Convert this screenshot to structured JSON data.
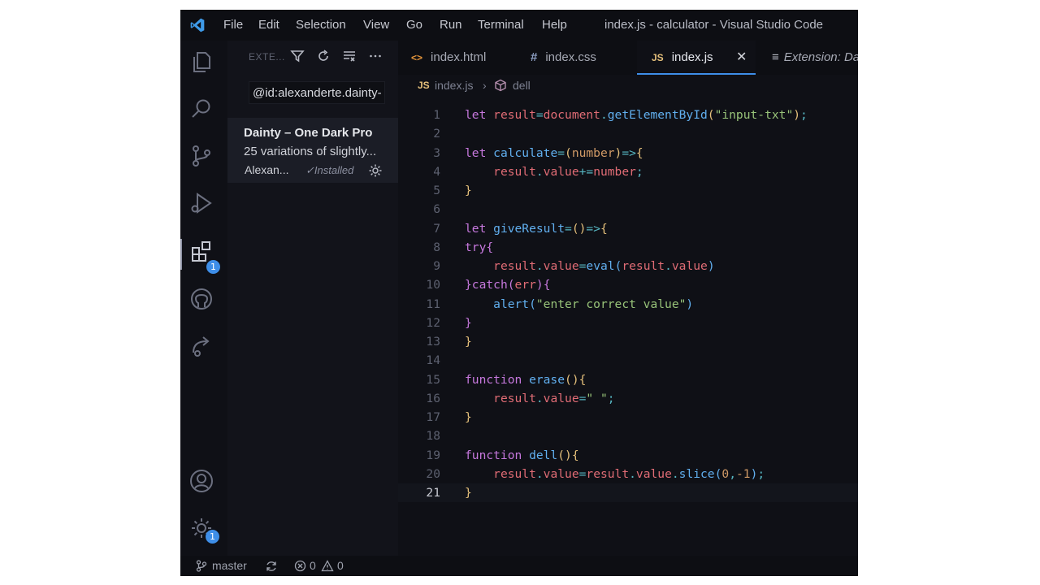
{
  "titlebar": {
    "menus": [
      "File",
      "Edit",
      "Selection",
      "View",
      "Go",
      "Run",
      "Terminal",
      "Help"
    ],
    "window_title": "index.js - calculator - Visual Studio Code"
  },
  "activity": {
    "extensions_badge": "1",
    "settings_badge": "1"
  },
  "sidebar": {
    "title": "EXTE...",
    "search_value": "@id:alexanderte.dainty-",
    "extension": {
      "name": "Dainty – One Dark Pro",
      "description": "25 variations of slightly...",
      "publisher": "Alexan...",
      "status": "✓Installed"
    }
  },
  "tabs": [
    {
      "icon": "<>",
      "label": "index.html"
    },
    {
      "icon": "#",
      "label": "index.css"
    },
    {
      "icon": "JS",
      "label": "index.js",
      "close": "✕"
    },
    {
      "icon": "≡",
      "label": "Extension: Dainty"
    }
  ],
  "breadcrumb": {
    "icon": "JS",
    "file": "index.js",
    "sep": "›",
    "symbol": "dell"
  },
  "editor": {
    "lines": [
      [
        [
          "let ",
          "kw"
        ],
        [
          "result",
          "var"
        ],
        [
          "=",
          "op"
        ],
        [
          "document",
          "var"
        ],
        [
          ".",
          "op"
        ],
        [
          "getElementById",
          "fn"
        ],
        [
          "(",
          "p1"
        ],
        [
          "\"input-txt\"",
          "str"
        ],
        [
          ")",
          "p1"
        ],
        [
          ";",
          "op"
        ]
      ],
      [],
      [
        [
          "let ",
          "kw"
        ],
        [
          "calculate",
          "fn"
        ],
        [
          "=",
          "op"
        ],
        [
          "(",
          "p1"
        ],
        [
          "number",
          "param"
        ],
        [
          ")",
          "p1"
        ],
        [
          "=>",
          "op"
        ],
        [
          "{",
          "p1"
        ]
      ],
      [
        [
          "    "
        ],
        [
          "result",
          "var"
        ],
        [
          ".",
          "op"
        ],
        [
          "value",
          "var"
        ],
        [
          "+=",
          "op"
        ],
        [
          "number",
          "var"
        ],
        [
          ";",
          "op"
        ]
      ],
      [
        [
          "}",
          "p1"
        ]
      ],
      [],
      [
        [
          "let ",
          "kw"
        ],
        [
          "giveResult",
          "fn"
        ],
        [
          "=",
          "op"
        ],
        [
          "(",
          "p1"
        ],
        [
          ")",
          "p1"
        ],
        [
          "=>",
          "op"
        ],
        [
          "{",
          "p1"
        ]
      ],
      [
        [
          "try",
          "kw"
        ],
        [
          "{",
          "p2"
        ]
      ],
      [
        [
          "    "
        ],
        [
          "result",
          "var"
        ],
        [
          ".",
          "op"
        ],
        [
          "value",
          "var"
        ],
        [
          "=",
          "op"
        ],
        [
          "eval",
          "fn"
        ],
        [
          "(",
          "p3"
        ],
        [
          "result",
          "var"
        ],
        [
          ".",
          "op"
        ],
        [
          "value",
          "var"
        ],
        [
          ")",
          "p3"
        ]
      ],
      [
        [
          "}",
          "p2"
        ],
        [
          "catch",
          "kw"
        ],
        [
          "(",
          "p2"
        ],
        [
          "err",
          "var"
        ],
        [
          ")",
          "p2"
        ],
        [
          "{",
          "p2"
        ]
      ],
      [
        [
          "    "
        ],
        [
          "alert",
          "fn"
        ],
        [
          "(",
          "p3"
        ],
        [
          "\"enter correct value\"",
          "str"
        ],
        [
          ")",
          "p3"
        ]
      ],
      [
        [
          "}",
          "p2"
        ]
      ],
      [
        [
          "}",
          "p1"
        ]
      ],
      [],
      [
        [
          "function ",
          "kw"
        ],
        [
          "erase",
          "fn"
        ],
        [
          "(",
          "p1"
        ],
        [
          ")",
          "p1"
        ],
        [
          "{",
          "p1"
        ]
      ],
      [
        [
          "    "
        ],
        [
          "result",
          "var"
        ],
        [
          ".",
          "op"
        ],
        [
          "value",
          "var"
        ],
        [
          "=",
          "op"
        ],
        [
          "\" \"",
          "str"
        ],
        [
          ";",
          "op"
        ]
      ],
      [
        [
          "}",
          "p1"
        ]
      ],
      [],
      [
        [
          "function ",
          "kw"
        ],
        [
          "dell",
          "fn"
        ],
        [
          "(",
          "p1"
        ],
        [
          ")",
          "p1"
        ],
        [
          "{",
          "p1"
        ]
      ],
      [
        [
          "    "
        ],
        [
          "result",
          "var"
        ],
        [
          ".",
          "op"
        ],
        [
          "value",
          "var"
        ],
        [
          "=",
          "op"
        ],
        [
          "result",
          "var"
        ],
        [
          ".",
          "op"
        ],
        [
          "value",
          "var"
        ],
        [
          ".",
          "op"
        ],
        [
          "slice",
          "fn"
        ],
        [
          "(",
          "p3"
        ],
        [
          "0",
          "num"
        ],
        [
          ",",
          "op"
        ],
        [
          "-1",
          "num"
        ],
        [
          ")",
          "p3"
        ],
        [
          ";",
          "op"
        ]
      ],
      [
        [
          "}",
          "p1"
        ]
      ]
    ]
  },
  "status": {
    "branch": "master",
    "errors": "0",
    "warnings": "0"
  },
  "colors": {
    "kw": "#c678dd",
    "var": "#e06c75",
    "fn": "#61afef",
    "str": "#98c379",
    "op": "#56b6c2",
    "param": "#d19a66",
    "num": "#d19a66",
    "p1": "#e5c07b",
    "p2": "#c678dd",
    "p3": "#61afef",
    "plain": "#c9cbd3"
  }
}
